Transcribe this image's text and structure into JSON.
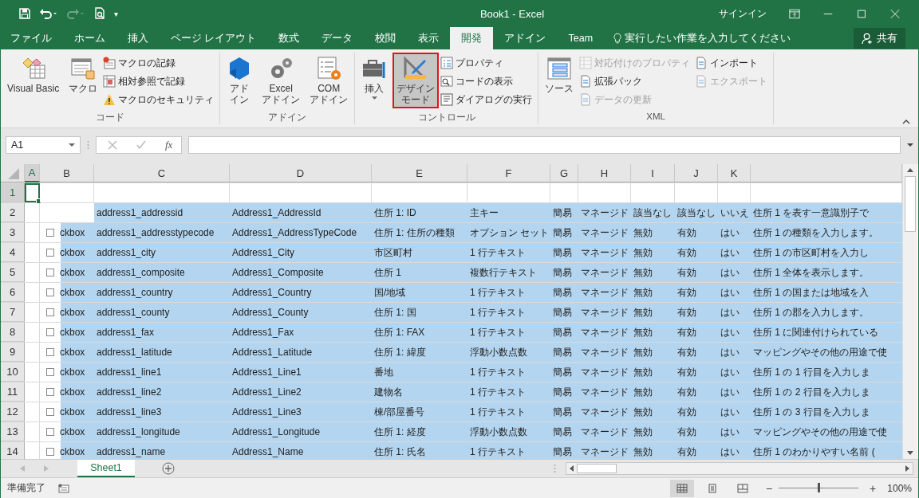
{
  "window": {
    "title": "Book1 - Excel",
    "sign_in": "サインイン"
  },
  "quick_access": {
    "more": "▾"
  },
  "tabs": [
    {
      "label": "ファイル",
      "selected": false
    },
    {
      "label": "ホーム",
      "selected": false
    },
    {
      "label": "挿入",
      "selected": false
    },
    {
      "label": "ページ レイアウト",
      "selected": false
    },
    {
      "label": "数式",
      "selected": false
    },
    {
      "label": "データ",
      "selected": false
    },
    {
      "label": "校閲",
      "selected": false
    },
    {
      "label": "表示",
      "selected": false
    },
    {
      "label": "開発",
      "selected": true
    },
    {
      "label": "アドイン",
      "selected": false
    },
    {
      "label": "Team",
      "selected": false
    }
  ],
  "tell_me": {
    "placeholder": "実行したい作業を入力してください"
  },
  "share": "共有",
  "ribbon_groups": [
    {
      "label": "コード",
      "items": [
        {
          "kind": "large",
          "lines": [
            "Visual Basic"
          ],
          "selected": false,
          "dropdown": false
        },
        {
          "kind": "large",
          "lines": [
            "マクロ"
          ],
          "selected": false,
          "dropdown": false
        },
        {
          "kind": "stack",
          "items": [
            {
              "label": "マクロの記録",
              "disabled": false
            },
            {
              "label": "相対参照で記録",
              "disabled": false
            },
            {
              "label": "マクロのセキュリティ",
              "disabled": false
            }
          ]
        }
      ]
    },
    {
      "label": "アドイン",
      "items": [
        {
          "kind": "large",
          "lines": [
            "アド",
            "イン"
          ],
          "selected": false,
          "dropdown": false
        },
        {
          "kind": "large",
          "lines": [
            "Excel",
            "アドイン"
          ],
          "selected": false,
          "dropdown": false
        },
        {
          "kind": "large",
          "lines": [
            "COM",
            "アドイン"
          ],
          "selected": false,
          "dropdown": false
        }
      ]
    },
    {
      "label": "コントロール",
      "items": [
        {
          "kind": "large",
          "lines": [
            "挿入"
          ],
          "selected": false,
          "dropdown": true
        },
        {
          "kind": "large",
          "lines": [
            "デザイン",
            "モード"
          ],
          "selected": true,
          "dropdown": false
        },
        {
          "kind": "stack",
          "items": [
            {
              "label": "プロパティ",
              "disabled": false
            },
            {
              "label": "コードの表示",
              "disabled": false
            },
            {
              "label": "ダイアログの実行",
              "disabled": false
            }
          ]
        }
      ]
    },
    {
      "label": "XML",
      "items": [
        {
          "kind": "large",
          "lines": [
            "ソース"
          ],
          "selected": false,
          "dropdown": false
        },
        {
          "kind": "stack",
          "items": [
            {
              "label": "対応付けのプロパティ",
              "disabled": true
            },
            {
              "label": "拡張パック",
              "disabled": false
            },
            {
              "label": "データの更新",
              "disabled": true
            }
          ]
        },
        {
          "kind": "stack",
          "items": [
            {
              "label": "インポート",
              "disabled": false
            },
            {
              "label": "エクスポート",
              "disabled": true
            }
          ]
        }
      ]
    }
  ],
  "formula_bar": {
    "name_box": "A1",
    "fx": "fx"
  },
  "columns": [
    {
      "label": "A",
      "selected": true
    },
    {
      "label": "B",
      "selected": false
    },
    {
      "label": "C",
      "selected": false
    },
    {
      "label": "D",
      "selected": false
    },
    {
      "label": "E",
      "selected": false
    },
    {
      "label": "F",
      "selected": false
    },
    {
      "label": "G",
      "selected": false
    },
    {
      "label": "H",
      "selected": false
    },
    {
      "label": "I",
      "selected": false
    },
    {
      "label": "J",
      "selected": false
    },
    {
      "label": "K",
      "selected": false
    }
  ],
  "rows": [
    {
      "number": "1",
      "selected": true,
      "highlighted": false,
      "cells": {}
    },
    {
      "number": "2",
      "selected": false,
      "highlighted": true,
      "cells": {
        "C": "address1_addressid",
        "D": "Address1_AddressId",
        "E": "住所 1: ID",
        "F": "主キー",
        "G": "簡易",
        "H": "マネージド",
        "I": "該当なし",
        "J": "該当なし",
        "K": "いいえ",
        "L": "住所 1 を表す一意識別子で"
      }
    },
    {
      "number": "3",
      "selected": false,
      "highlighted": true,
      "checkbox": {
        "checked": false
      },
      "cells": {
        "B": "ckbox",
        "C": "address1_addresstypecode",
        "D": "Address1_AddressTypeCode",
        "E": "住所 1: 住所の種類",
        "F": "オプション セット",
        "G": "簡易",
        "H": "マネージド",
        "I": "無効",
        "J": "有効",
        "K": "はい",
        "L": "住所 1 の種類を入力します。"
      }
    },
    {
      "number": "4",
      "selected": false,
      "highlighted": true,
      "checkbox": {
        "checked": false
      },
      "cells": {
        "B": "ckbox",
        "C": "address1_city",
        "D": "Address1_City",
        "E": "市区町村",
        "F": "1 行テキスト",
        "G": "簡易",
        "H": "マネージド",
        "I": "無効",
        "J": "有効",
        "K": "はい",
        "L": "住所 1 の市区町村を入力し"
      }
    },
    {
      "number": "5",
      "selected": false,
      "highlighted": true,
      "checkbox": {
        "checked": false
      },
      "cells": {
        "B": "ckbox",
        "C": "address1_composite",
        "D": "Address1_Composite",
        "E": "住所 1",
        "F": "複数行テキスト",
        "G": "簡易",
        "H": "マネージド",
        "I": "無効",
        "J": "有効",
        "K": "はい",
        "L": "住所 1 全体を表示します。"
      }
    },
    {
      "number": "6",
      "selected": false,
      "highlighted": true,
      "checkbox": {
        "checked": false
      },
      "cells": {
        "B": "ckbox",
        "C": "address1_country",
        "D": "Address1_Country",
        "E": "国/地域",
        "F": "1 行テキスト",
        "G": "簡易",
        "H": "マネージド",
        "I": "無効",
        "J": "有効",
        "K": "はい",
        "L": "住所 1 の国または地域を入"
      }
    },
    {
      "number": "7",
      "selected": false,
      "highlighted": true,
      "checkbox": {
        "checked": false
      },
      "cells": {
        "B": "ckbox",
        "C": "address1_county",
        "D": "Address1_County",
        "E": "住所 1: 国",
        "F": "1 行テキスト",
        "G": "簡易",
        "H": "マネージド",
        "I": "無効",
        "J": "有効",
        "K": "はい",
        "L": "住所 1 の郡を入力します。"
      }
    },
    {
      "number": "8",
      "selected": false,
      "highlighted": true,
      "checkbox": {
        "checked": false
      },
      "cells": {
        "B": "ckbox",
        "C": "address1_fax",
        "D": "Address1_Fax",
        "E": "住所 1: FAX",
        "F": "1 行テキスト",
        "G": "簡易",
        "H": "マネージド",
        "I": "無効",
        "J": "有効",
        "K": "はい",
        "L": "住所 1 に関連付けられている"
      }
    },
    {
      "number": "9",
      "selected": false,
      "highlighted": true,
      "checkbox": {
        "checked": false
      },
      "cells": {
        "B": "ckbox",
        "C": "address1_latitude",
        "D": "Address1_Latitude",
        "E": "住所 1: 緯度",
        "F": "浮動小数点数",
        "G": "簡易",
        "H": "マネージド",
        "I": "無効",
        "J": "有効",
        "K": "はい",
        "L": "マッピングやその他の用途で使"
      }
    },
    {
      "number": "10",
      "selected": false,
      "highlighted": true,
      "checkbox": {
        "checked": false
      },
      "cells": {
        "B": "ckbox",
        "C": "address1_line1",
        "D": "Address1_Line1",
        "E": "番地",
        "F": "1 行テキスト",
        "G": "簡易",
        "H": "マネージド",
        "I": "無効",
        "J": "有効",
        "K": "はい",
        "L": "住所 1 の 1 行目を入力しま"
      }
    },
    {
      "number": "11",
      "selected": false,
      "highlighted": true,
      "checkbox": {
        "checked": false
      },
      "cells": {
        "B": "ckbox",
        "C": "address1_line2",
        "D": "Address1_Line2",
        "E": "建物名",
        "F": "1 行テキスト",
        "G": "簡易",
        "H": "マネージド",
        "I": "無効",
        "J": "有効",
        "K": "はい",
        "L": "住所 1 の 2 行目を入力しま"
      }
    },
    {
      "number": "12",
      "selected": false,
      "highlighted": true,
      "checkbox": {
        "checked": false
      },
      "cells": {
        "B": "ckbox",
        "C": "address1_line3",
        "D": "Address1_Line3",
        "E": "棟/部屋番号",
        "F": "1 行テキスト",
        "G": "簡易",
        "H": "マネージド",
        "I": "無効",
        "J": "有効",
        "K": "はい",
        "L": "住所 1 の 3 行目を入力しま"
      }
    },
    {
      "number": "13",
      "selected": false,
      "highlighted": true,
      "checkbox": {
        "checked": false
      },
      "cells": {
        "B": "ckbox",
        "C": "address1_longitude",
        "D": "Address1_Longitude",
        "E": "住所 1: 経度",
        "F": "浮動小数点数",
        "G": "簡易",
        "H": "マネージド",
        "I": "無効",
        "J": "有効",
        "K": "はい",
        "L": "マッピングやその他の用途で使"
      }
    },
    {
      "number": "14",
      "selected": false,
      "highlighted": true,
      "checkbox": {
        "checked": false
      },
      "cells": {
        "B": "ckbox",
        "C": "address1_name",
        "D": "Address1_Name",
        "E": "住所 1: 氏名",
        "F": "1 行テキスト",
        "G": "簡易",
        "H": "マネージド",
        "I": "無効",
        "J": "有効",
        "K": "はい",
        "L": "住所 1 のわかりやすい名前 ("
      }
    }
  ],
  "sheet_tabs": [
    {
      "label": "Sheet1",
      "selected": true
    }
  ],
  "status_bar": {
    "status": "準備完了",
    "zoom_out": "−",
    "zoom_in": "+",
    "zoom": "100%",
    "zoom_slider": {
      "level": 0.5
    },
    "views": [
      {
        "selected": true
      },
      {
        "selected": false
      },
      {
        "selected": false
      }
    ]
  }
}
